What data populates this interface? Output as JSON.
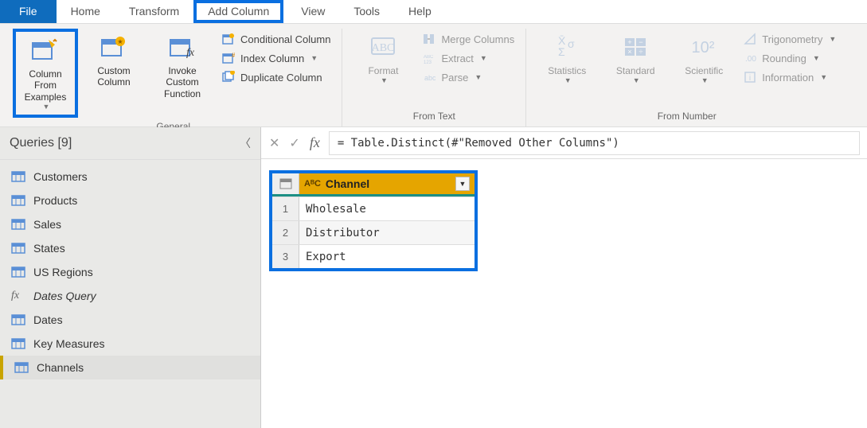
{
  "menu": {
    "file": "File",
    "tabs": [
      "Home",
      "Transform",
      "Add Column",
      "View",
      "Tools",
      "Help"
    ],
    "active_highlight": "Add Column"
  },
  "ribbon": {
    "general": {
      "label": "General",
      "column_from_examples": "Column From Examples",
      "custom_column": "Custom Column",
      "invoke_custom_function": "Invoke Custom Function",
      "conditional_column": "Conditional Column",
      "index_column": "Index Column",
      "duplicate_column": "Duplicate Column"
    },
    "from_text": {
      "label": "From Text",
      "format": "Format",
      "merge_columns": "Merge Columns",
      "extract": "Extract",
      "parse": "Parse"
    },
    "from_number": {
      "label": "From Number",
      "statistics": "Statistics",
      "standard": "Standard",
      "scientific": "Scientific",
      "trigonometry": "Trigonometry",
      "rounding": "Rounding",
      "information": "Information"
    }
  },
  "queries": {
    "header": "Queries [9]",
    "items": [
      {
        "label": "Customers",
        "type": "table"
      },
      {
        "label": "Products",
        "type": "table"
      },
      {
        "label": "Sales",
        "type": "table"
      },
      {
        "label": "States",
        "type": "table"
      },
      {
        "label": "US Regions",
        "type": "table"
      },
      {
        "label": "Dates Query",
        "type": "fx"
      },
      {
        "label": "Dates",
        "type": "table"
      },
      {
        "label": "Key Measures",
        "type": "table"
      },
      {
        "label": "Channels",
        "type": "table",
        "active": true
      }
    ]
  },
  "formula": "= Table.Distinct(#\"Removed Other Columns\")",
  "table": {
    "column_type": "AᴮC",
    "column_name": "Channel",
    "rows": [
      "Wholesale",
      "Distributor",
      "Export"
    ]
  }
}
